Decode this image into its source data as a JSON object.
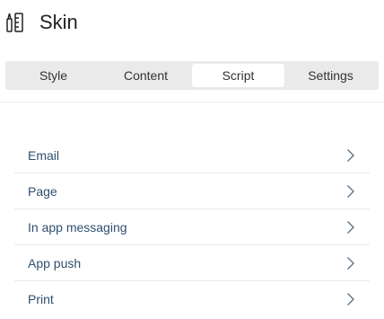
{
  "header": {
    "icon": "skin-palette-icon",
    "title": "Skin"
  },
  "tabs": [
    {
      "label": "Style",
      "active": false
    },
    {
      "label": "Content",
      "active": false
    },
    {
      "label": "Script",
      "active": true
    },
    {
      "label": "Settings",
      "active": false
    }
  ],
  "list": {
    "items": [
      {
        "label": "Email",
        "icon": "chevron-right-icon"
      },
      {
        "label": "Page",
        "icon": "chevron-right-icon"
      },
      {
        "label": "In app messaging",
        "icon": "chevron-right-icon"
      },
      {
        "label": "App push",
        "icon": "chevron-right-icon"
      },
      {
        "label": "Print",
        "icon": "chevron-right-icon"
      }
    ]
  },
  "colors": {
    "tab_bar_background": "#eaeaea",
    "active_tab_background": "#ffffff",
    "list_label": "#2f4f6f",
    "chevron": "#5a6f85"
  }
}
